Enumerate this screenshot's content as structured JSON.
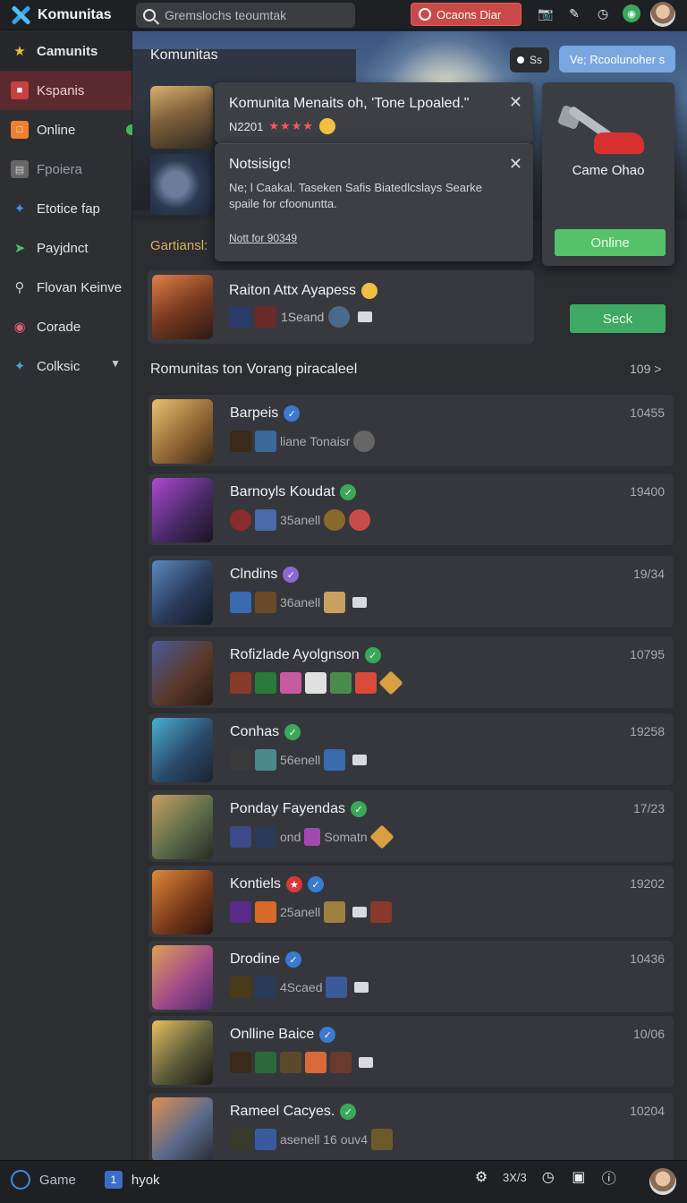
{
  "app": {
    "title": "Komunitas"
  },
  "search": {
    "placeholder": "Gremslochs teoumtak"
  },
  "topbar": {
    "alert_label": "Ocaons Diar",
    "icons": [
      "camera-icon",
      "pen-icon",
      "clock-icon",
      "shield-icon"
    ]
  },
  "sidebar": {
    "items": [
      {
        "label": "Camunits",
        "icon": "star-icon",
        "color": "#f0c030"
      },
      {
        "label": "Kspanis",
        "icon": "camera-icon",
        "color": "#e05050"
      },
      {
        "label": "Online",
        "icon": "box-icon",
        "color": "#f08030"
      },
      {
        "label": "Fpoiera",
        "icon": "doc-icon",
        "color": "#888888"
      },
      {
        "label": "Etotice fap",
        "icon": "puzzle-icon",
        "color": "#4a90e0"
      },
      {
        "label": "Payjdnct",
        "icon": "leaf-icon",
        "color": "#50c060"
      },
      {
        "label": "Flovan Keinve",
        "icon": "search-icon",
        "color": "#cccccc"
      },
      {
        "label": "Corade",
        "icon": "lips-icon",
        "color": "#e06080"
      },
      {
        "label": "Colksic",
        "icon": "puzzle-icon",
        "color": "#4aa0e0"
      }
    ]
  },
  "hero": {
    "title": "Komunitas",
    "pill_s": "Ss",
    "pill_blue": "Ve; Rcoolunoher s"
  },
  "popup1": {
    "title": "Komunita Menaits oh, 'Tone Lpoaled.\"",
    "code": "N2201",
    "stars": "★★★★"
  },
  "popup2": {
    "title": "Notsisigc!",
    "body": "Ne; l Caakal. Taseken Safis Biatedlcslays Searke spaile for cfoonuntta.",
    "link": "Nott for 90349"
  },
  "side_card": {
    "title": "Came Ohao",
    "button": "Online"
  },
  "games_label": "Gartiansl:",
  "featured": {
    "title": "Raiton Attx Ayapess",
    "tag": "1Seand"
  },
  "sack_button": "Seck",
  "section": {
    "title": "Romunitas ton Vorang piracaleel",
    "count": "109 >"
  },
  "rows": [
    {
      "title": "Barpeis",
      "badge": "blue",
      "tag": "liane Tonaisr",
      "num": "10455"
    },
    {
      "title": "Barnoyls Koudat",
      "badge": "green",
      "tag": "35anell",
      "num": "19400"
    },
    {
      "title": "Clndins",
      "badge": "purple",
      "tag": "36anell",
      "num": "19/34"
    },
    {
      "title": "Rofizlade Ayolgnson",
      "badge": "green",
      "tag": "",
      "num": "10795"
    },
    {
      "title": "Conhas",
      "badge": "green",
      "tag": "56enell",
      "num": "19258"
    },
    {
      "title": "Ponday Fayendas",
      "badge": "green",
      "tag": "ond",
      "num": "17/23"
    },
    {
      "title": "Kontiels",
      "badge": "blue",
      "tag": "25anell",
      "num": "19202"
    },
    {
      "title": "Drodine",
      "badge": "blue",
      "tag": "4Scaed",
      "num": "10436"
    },
    {
      "title": "Onlline Baice",
      "badge": "blue",
      "tag": "",
      "num": "10/06"
    },
    {
      "title": "Rameel Cacyes.",
      "badge": "green",
      "tag": "asenell   16 ouv4",
      "num": "10204"
    }
  ],
  "bottombar": {
    "game_label": "Game",
    "tab_num": "1",
    "tab_label": "hyok",
    "counter": "3X/3"
  }
}
